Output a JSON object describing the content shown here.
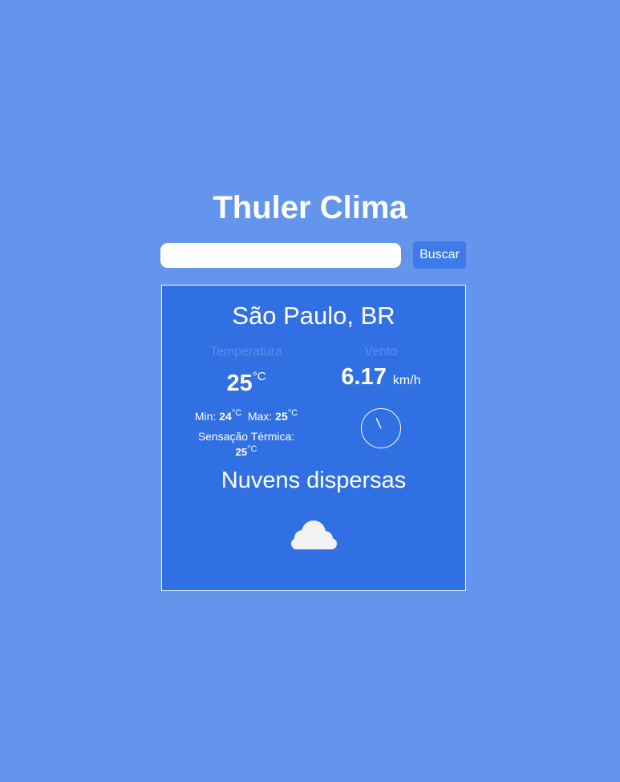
{
  "app": {
    "title": "Thuler Clima"
  },
  "search": {
    "placeholder": "",
    "value": "",
    "button_label": "Buscar"
  },
  "weather": {
    "city": "São Paulo, BR",
    "temperature_label": "Temperatura",
    "temperature": "25",
    "unit": "°C",
    "min_label": "Min:",
    "min": "24",
    "max_label": "Max:",
    "max": "25",
    "feels_label": "Sensação Térmica:",
    "feels": "25",
    "wind_label": "Vento",
    "wind_speed": "6.17",
    "wind_unit": "km/h",
    "wind_direction_deg": 155,
    "description": "Nuvens dispersas",
    "icon": "cloud-icon"
  },
  "colors": {
    "background": "#6495ED",
    "card": "#3170E3",
    "button": "#3E7BE8",
    "muted": "#5B8FEA",
    "icon": "#F2F2F2"
  }
}
